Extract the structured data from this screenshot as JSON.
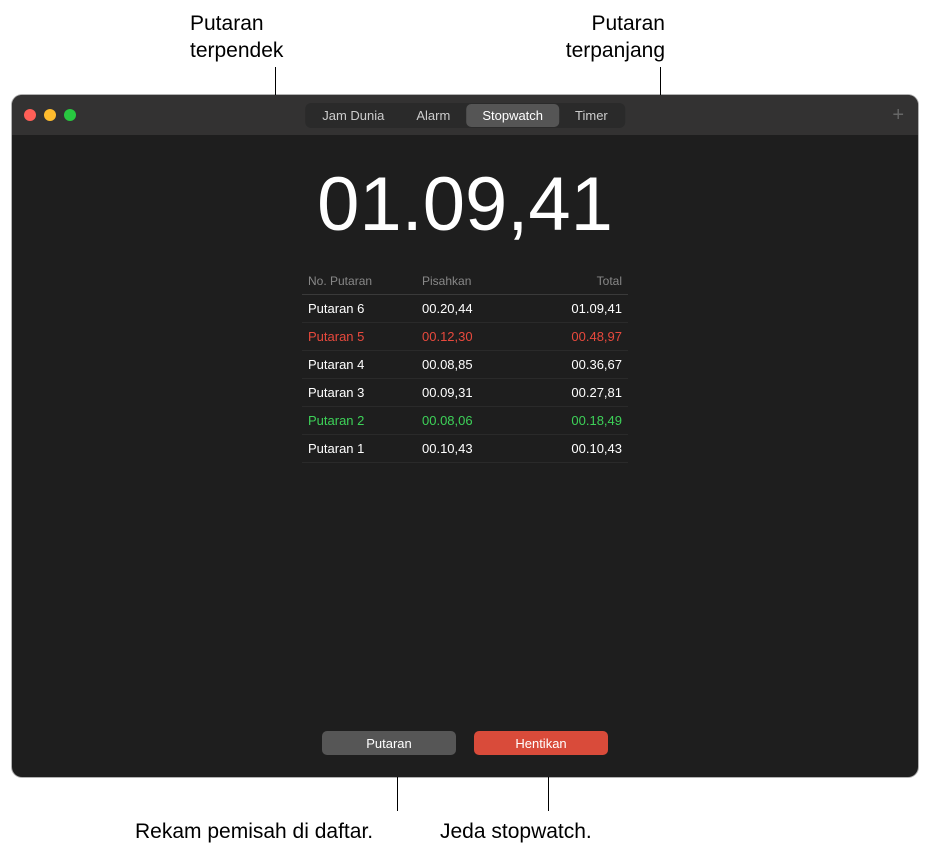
{
  "callouts": {
    "shortest": "Putaran\nterpendek",
    "longest": "Putaran\nterpanjang",
    "record_split": "Rekam pemisah di daftar.",
    "pause": "Jeda stopwatch."
  },
  "tabs": {
    "world_clock": "Jam Dunia",
    "alarm": "Alarm",
    "stopwatch": "Stopwatch",
    "timer": "Timer"
  },
  "time": "01.09,41",
  "table_headers": {
    "lap": "No. Putaran",
    "split": "Pisahkan",
    "total": "Total"
  },
  "laps": [
    {
      "name": "Putaran 6",
      "split": "00.20,44",
      "total": "01.09,41",
      "type": "normal"
    },
    {
      "name": "Putaran 5",
      "split": "00.12,30",
      "total": "00.48,97",
      "type": "longest"
    },
    {
      "name": "Putaran 4",
      "split": "00.08,85",
      "total": "00.36,67",
      "type": "normal"
    },
    {
      "name": "Putaran 3",
      "split": "00.09,31",
      "total": "00.27,81",
      "type": "normal"
    },
    {
      "name": "Putaran 2",
      "split": "00.08,06",
      "total": "00.18,49",
      "type": "shortest"
    },
    {
      "name": "Putaran 1",
      "split": "00.10,43",
      "total": "00.10,43",
      "type": "normal"
    }
  ],
  "buttons": {
    "lap": "Putaran",
    "stop": "Hentikan"
  }
}
